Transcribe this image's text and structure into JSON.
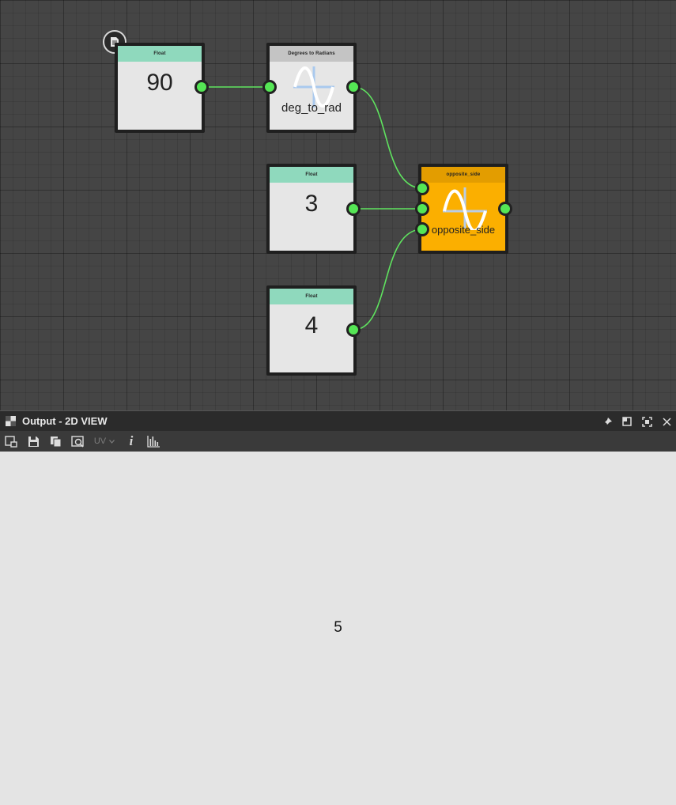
{
  "graph": {
    "nodes": [
      {
        "id": "float90",
        "header": "Float",
        "value": "90",
        "header_color": "#8fd9bd"
      },
      {
        "id": "deg2rad",
        "header": "Degrees to Radians",
        "label": "deg_to_rad",
        "header_color": "#c4c4c4"
      },
      {
        "id": "float3",
        "header": "Float",
        "value": "3",
        "header_color": "#8fd9bd"
      },
      {
        "id": "float4",
        "header": "Float",
        "value": "4",
        "header_color": "#8fd9bd"
      },
      {
        "id": "opposite",
        "header": "opposite_side",
        "label": "opposite_side",
        "header_color": "#e39d00",
        "body_color": "#fbaf00"
      }
    ],
    "wire_color": "#5fe35f",
    "port_color": "#55e655"
  },
  "panel": {
    "title": "Output - 2D VIEW",
    "uv_label": "UV",
    "info_label": "i"
  },
  "icons": {
    "panel": "checker-icon",
    "toolbar": [
      "new-window-icon",
      "save-icon",
      "copy-icon",
      "preview-icon",
      "uv-dropdown",
      "info-icon",
      "histogram-icon"
    ],
    "window": [
      "pin-icon",
      "dock-icon",
      "maximize-icon",
      "close-icon"
    ],
    "badge": "document-icon"
  },
  "output": {
    "value": "5"
  }
}
